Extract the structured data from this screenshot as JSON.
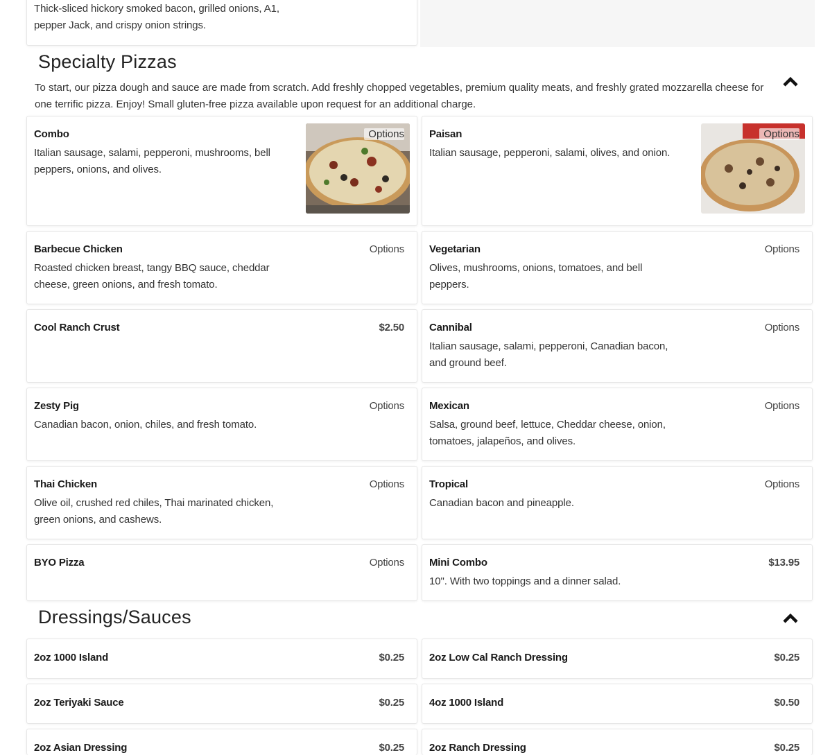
{
  "top_item": {
    "desc": "Thick-sliced hickory smoked bacon, grilled onions, A1, pepper Jack, and crispy onion strings."
  },
  "specialty": {
    "title": "Specialty Pizzas",
    "intro": "To start, our pizza dough and sauce are made from scratch. Add freshly chopped vegetables, premium quality meats, and freshly grated mozzarella cheese for one terrific pizza. Enjoy! Small gluten-free pizza available upon request for an additional charge.",
    "collapse_icon": "chevron-up-icon",
    "items": [
      {
        "name": "Combo",
        "desc": "Italian sausage, salami, pepperoni, mushrooms, bell peppers, onions, and olives.",
        "action": "Options"
      },
      {
        "name": "Paisan",
        "desc": "Italian sausage, pepperoni, salami, olives, and onion.",
        "action": "Options"
      },
      {
        "name": "Barbecue Chicken",
        "desc": "Roasted chicken breast, tangy BBQ sauce, cheddar cheese, green onions, and fresh tomato.",
        "action": "Options"
      },
      {
        "name": "Vegetarian",
        "desc": "Olives, mushrooms, onions, tomatoes, and bell peppers.",
        "action": "Options"
      },
      {
        "name": "Cool Ranch Crust",
        "desc": "",
        "price": "$2.50"
      },
      {
        "name": "Cannibal",
        "desc": "Italian sausage, salami, pepperoni, Canadian bacon, and ground beef.",
        "action": "Options"
      },
      {
        "name": "Zesty Pig",
        "desc": "Canadian bacon, onion, chiles, and fresh tomato.",
        "action": "Options"
      },
      {
        "name": "Mexican",
        "desc": "Salsa, ground beef, lettuce, Cheddar cheese, onion, tomatoes, jalapeños, and olives.",
        "action": "Options"
      },
      {
        "name": "Thai Chicken",
        "desc": "Olive oil, crushed red chiles, Thai marinated chicken, green onions, and cashews.",
        "action": "Options"
      },
      {
        "name": "Tropical",
        "desc": "Canadian bacon and pineapple.",
        "action": "Options"
      },
      {
        "name": "BYO Pizza",
        "desc": "",
        "action": "Options"
      },
      {
        "name": "Mini Combo",
        "desc": "10\". With two toppings and a dinner salad.",
        "price": "$13.95"
      }
    ]
  },
  "dressings": {
    "title": "Dressings/Sauces",
    "collapse_icon": "chevron-up-icon",
    "items": [
      {
        "name": "2oz 1000 Island",
        "price": "$0.25"
      },
      {
        "name": "2oz Low Cal Ranch Dressing",
        "price": "$0.25"
      },
      {
        "name": "2oz Teriyaki Sauce",
        "price": "$0.25"
      },
      {
        "name": "4oz 1000 Island",
        "price": "$0.50"
      },
      {
        "name": "2oz Asian Dressing",
        "price": "$0.25"
      },
      {
        "name": "2oz Ranch Dressing",
        "price": "$0.25"
      }
    ]
  }
}
